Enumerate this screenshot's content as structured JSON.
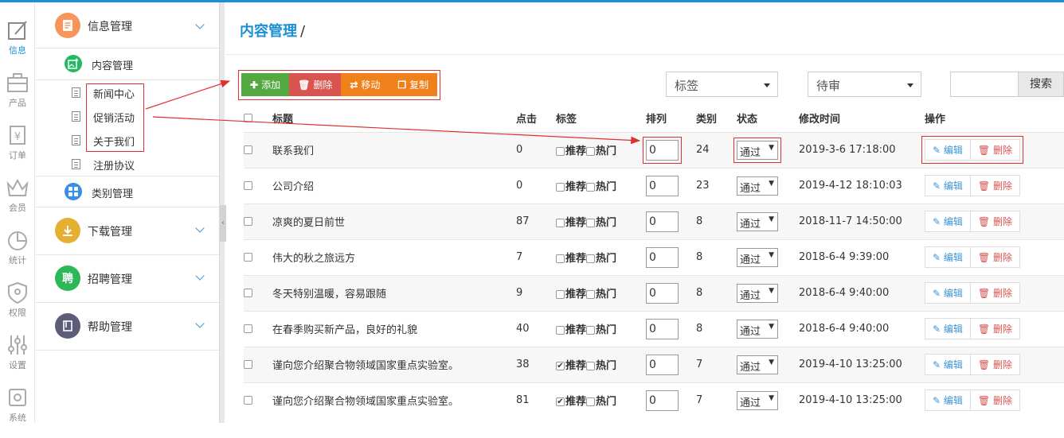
{
  "rail": [
    {
      "label": "信息",
      "icon": "edit-icon",
      "active": true
    },
    {
      "label": "产品",
      "icon": "briefcase-icon",
      "active": false
    },
    {
      "label": "订单",
      "icon": "yen-receipt-icon",
      "active": false
    },
    {
      "label": "会员",
      "icon": "crown-icon",
      "active": false
    },
    {
      "label": "统计",
      "icon": "pie-chart-icon",
      "active": false
    },
    {
      "label": "权限",
      "icon": "shield-icon",
      "active": false
    },
    {
      "label": "设置",
      "icon": "sliders-icon",
      "active": false
    },
    {
      "label": "系统",
      "icon": "gear-icon",
      "active": false
    }
  ],
  "menu": {
    "info": {
      "label": "信息管理",
      "icon": "document-icon",
      "color": "#f7955a"
    },
    "content": {
      "label": "内容管理",
      "icon": "image-add-icon",
      "color": "#25b864"
    },
    "leaves": [
      "新闻中心",
      "促销活动",
      "关于我们",
      "注册协议"
    ],
    "category": {
      "label": "类别管理",
      "icon": "grid-icon",
      "color": "#3a8ee6"
    },
    "download": {
      "label": "下载管理",
      "icon": "download-icon",
      "color": "#e5b031"
    },
    "recruit": {
      "label": "招聘管理",
      "glyph": "聘",
      "color": "#2db857"
    },
    "help": {
      "label": "帮助管理",
      "icon": "book-icon",
      "color": "#5d5d7a"
    }
  },
  "breadcrumb": {
    "current": "内容管理",
    "sep": "/"
  },
  "toolbar": {
    "add": "添加",
    "delete": "删除",
    "move": "移动",
    "copy": "复制"
  },
  "filters": {
    "tag": "标签",
    "status": "待审",
    "search_button": "搜索"
  },
  "table": {
    "headers": {
      "title": "标题",
      "clicks": "点击",
      "tags": "标签",
      "sort": "排列",
      "category": "类别",
      "status": "状态",
      "modified": "修改时间",
      "actions": "操作"
    },
    "tag_recommend": "推荐",
    "tag_hot": "热门",
    "edit_label": "编辑",
    "delete_label": "删除",
    "rows": [
      {
        "title": "联系我们",
        "clicks": "0",
        "recommend": false,
        "sort": "0",
        "category": "24",
        "status": "通过",
        "modified": "2019-3-6 17:18:00"
      },
      {
        "title": "公司介绍",
        "clicks": "0",
        "recommend": false,
        "sort": "0",
        "category": "23",
        "status": "通过",
        "modified": "2019-4-12 18:10:03"
      },
      {
        "title": "凉爽的夏日前世",
        "clicks": "87",
        "recommend": false,
        "sort": "0",
        "category": "8",
        "status": "通过",
        "modified": "2018-11-7 14:50:00"
      },
      {
        "title": "伟大的秋之旅远方",
        "clicks": "7",
        "recommend": false,
        "sort": "0",
        "category": "8",
        "status": "通过",
        "modified": "2018-6-4 9:39:00"
      },
      {
        "title": "冬天特别温暖，容易跟随",
        "clicks": "9",
        "recommend": false,
        "sort": "0",
        "category": "8",
        "status": "通过",
        "modified": "2018-6-4 9:40:00"
      },
      {
        "title": "在春季购买新产品，良好的礼貌",
        "clicks": "40",
        "recommend": false,
        "sort": "0",
        "category": "8",
        "status": "通过",
        "modified": "2018-6-4 9:40:00"
      },
      {
        "title": "谨向您介绍聚合物领域国家重点实验室。",
        "clicks": "38",
        "recommend": true,
        "sort": "0",
        "category": "7",
        "status": "通过",
        "modified": "2019-4-10 13:25:00"
      },
      {
        "title": "谨向您介绍聚合物领域国家重点实验室。",
        "clicks": "81",
        "recommend": true,
        "sort": "0",
        "category": "7",
        "status": "通过",
        "modified": "2019-4-10 13:25:00"
      }
    ]
  }
}
